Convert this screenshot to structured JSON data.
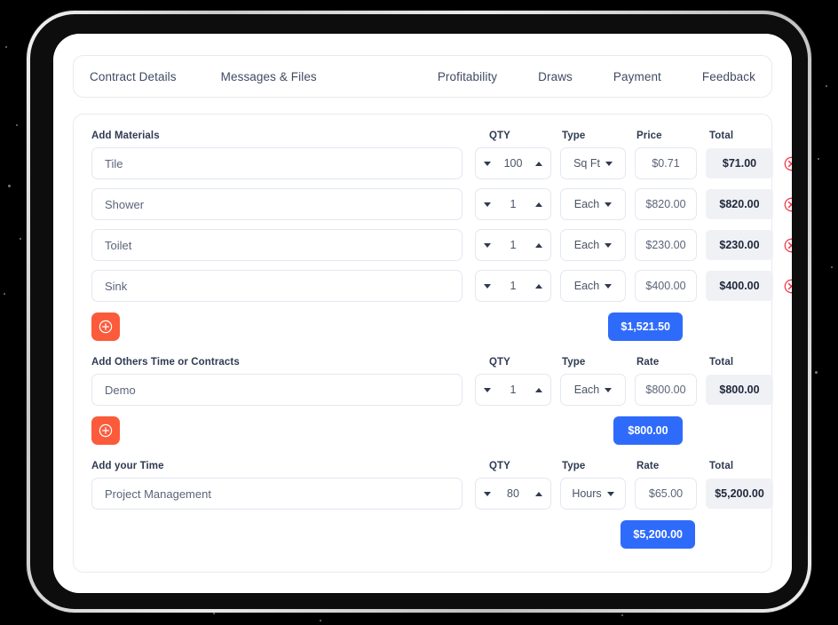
{
  "tabs": {
    "left": [
      {
        "label": "Contract Details",
        "name": "tab-contract-details"
      },
      {
        "label": "Messages & Files",
        "name": "tab-messages-files"
      }
    ],
    "right": [
      {
        "label": "Profitability",
        "name": "tab-profitability"
      },
      {
        "label": "Draws",
        "name": "tab-draws"
      },
      {
        "label": "Payment",
        "name": "tab-payment"
      },
      {
        "label": "Feedback",
        "name": "tab-feedback"
      }
    ]
  },
  "colors": {
    "accent_blue": "#2f6bfb",
    "accent_orange": "#fb5b3b",
    "delete_red": "#f0394b",
    "total_bg": "#f0f1f5",
    "text_dark": "#20293d"
  },
  "sections": [
    {
      "title": "Add Materials",
      "headers": {
        "qty": "QTY",
        "type": "Type",
        "price": "Price",
        "total": "Total"
      },
      "has_delete": true,
      "rows": [
        {
          "name": "Tile",
          "qty": "100",
          "type": "Sq Ft",
          "price": "$0.71",
          "total": "$71.00"
        },
        {
          "name": "Shower",
          "qty": "1",
          "type": "Each",
          "price": "$820.00",
          "total": "$820.00"
        },
        {
          "name": "Toilet",
          "qty": "1",
          "type": "Each",
          "price": "$230.00",
          "total": "$230.00"
        },
        {
          "name": "Sink",
          "qty": "1",
          "type": "Each",
          "price": "$400.00",
          "total": "$400.00"
        }
      ],
      "add_label": "+",
      "subtotal": "$1,521.50"
    },
    {
      "title": "Add Others Time or Contracts",
      "headers": {
        "qty": "QTY",
        "type": "Type",
        "price": "Rate",
        "total": "Total"
      },
      "has_delete": false,
      "rows": [
        {
          "name": "Demo",
          "qty": "1",
          "type": "Each",
          "price": "$800.00",
          "total": "$800.00"
        }
      ],
      "add_label": "+",
      "subtotal": "$800.00"
    },
    {
      "title": "Add your Time",
      "headers": {
        "qty": "QTY",
        "type": "Type",
        "price": "Rate",
        "total": "Total"
      },
      "has_delete": false,
      "has_add": false,
      "rows": [
        {
          "name": "Project Management",
          "qty": "80",
          "type": "Hours",
          "price": "$65.00",
          "total": "$5,200.00"
        }
      ],
      "subtotal": "$5,200.00"
    }
  ]
}
